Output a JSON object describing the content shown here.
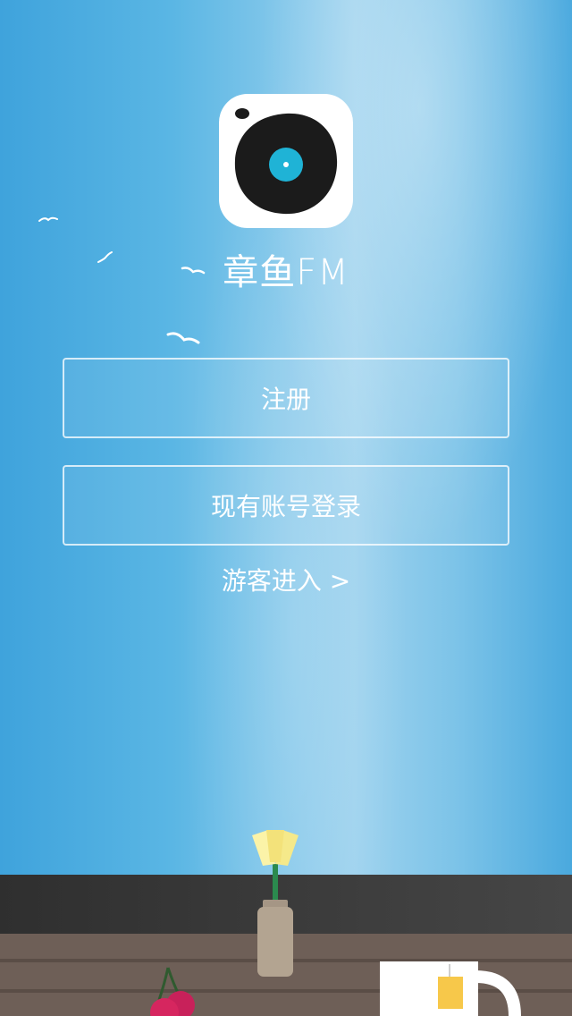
{
  "app": {
    "name": "章鱼FM"
  },
  "actions": {
    "register_label": "注册",
    "login_label": "现有账号登录",
    "guest_label": "游客进入 >"
  },
  "icons": {
    "logo": "vinyl-record-logo-icon",
    "decor": [
      "bird-icon",
      "flower-vase-icon",
      "cherry-icon",
      "tea-cup-icon"
    ]
  },
  "colors": {
    "sky_left": "#3fa3dc",
    "sky_light": "#9dd2ee",
    "wall": "#3a3a3a",
    "table": "#6e5f57",
    "record": "#1b1b1b",
    "record_center": "#1fb3d6"
  }
}
